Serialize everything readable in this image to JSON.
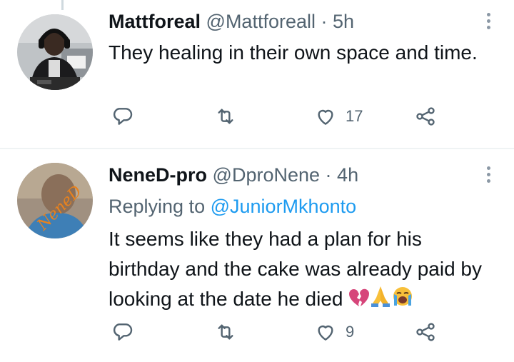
{
  "tweets": [
    {
      "display_name": "Mattforeal",
      "handle": "@Mattforeall",
      "separator": "·",
      "time": "5h",
      "text": "They healing in their own space and time.",
      "likes": "17"
    },
    {
      "display_name": "NeneD-pro",
      "handle": "@DproNene",
      "separator": "·",
      "time": "4h",
      "replying_prefix": "Replying to",
      "replying_handle": "@JuniorMkhonto",
      "text": "It seems like they had a plan for his birthday and the cake was already paid by looking at the date he died",
      "likes": "9",
      "emojis": [
        "broken-heart",
        "folded-hands",
        "loudly-crying-face"
      ],
      "avatar_watermark": "NeneD"
    }
  ],
  "icons": [
    "reply-icon",
    "retweet-icon",
    "like-icon",
    "share-icon",
    "more-icon"
  ],
  "colors": {
    "text": "#0f1419",
    "secondary": "#536471",
    "link": "#1d9bf0",
    "divider": "#eff3f4",
    "broken_heart": "#d6457a",
    "hands_emoji": "#f8c03a"
  }
}
